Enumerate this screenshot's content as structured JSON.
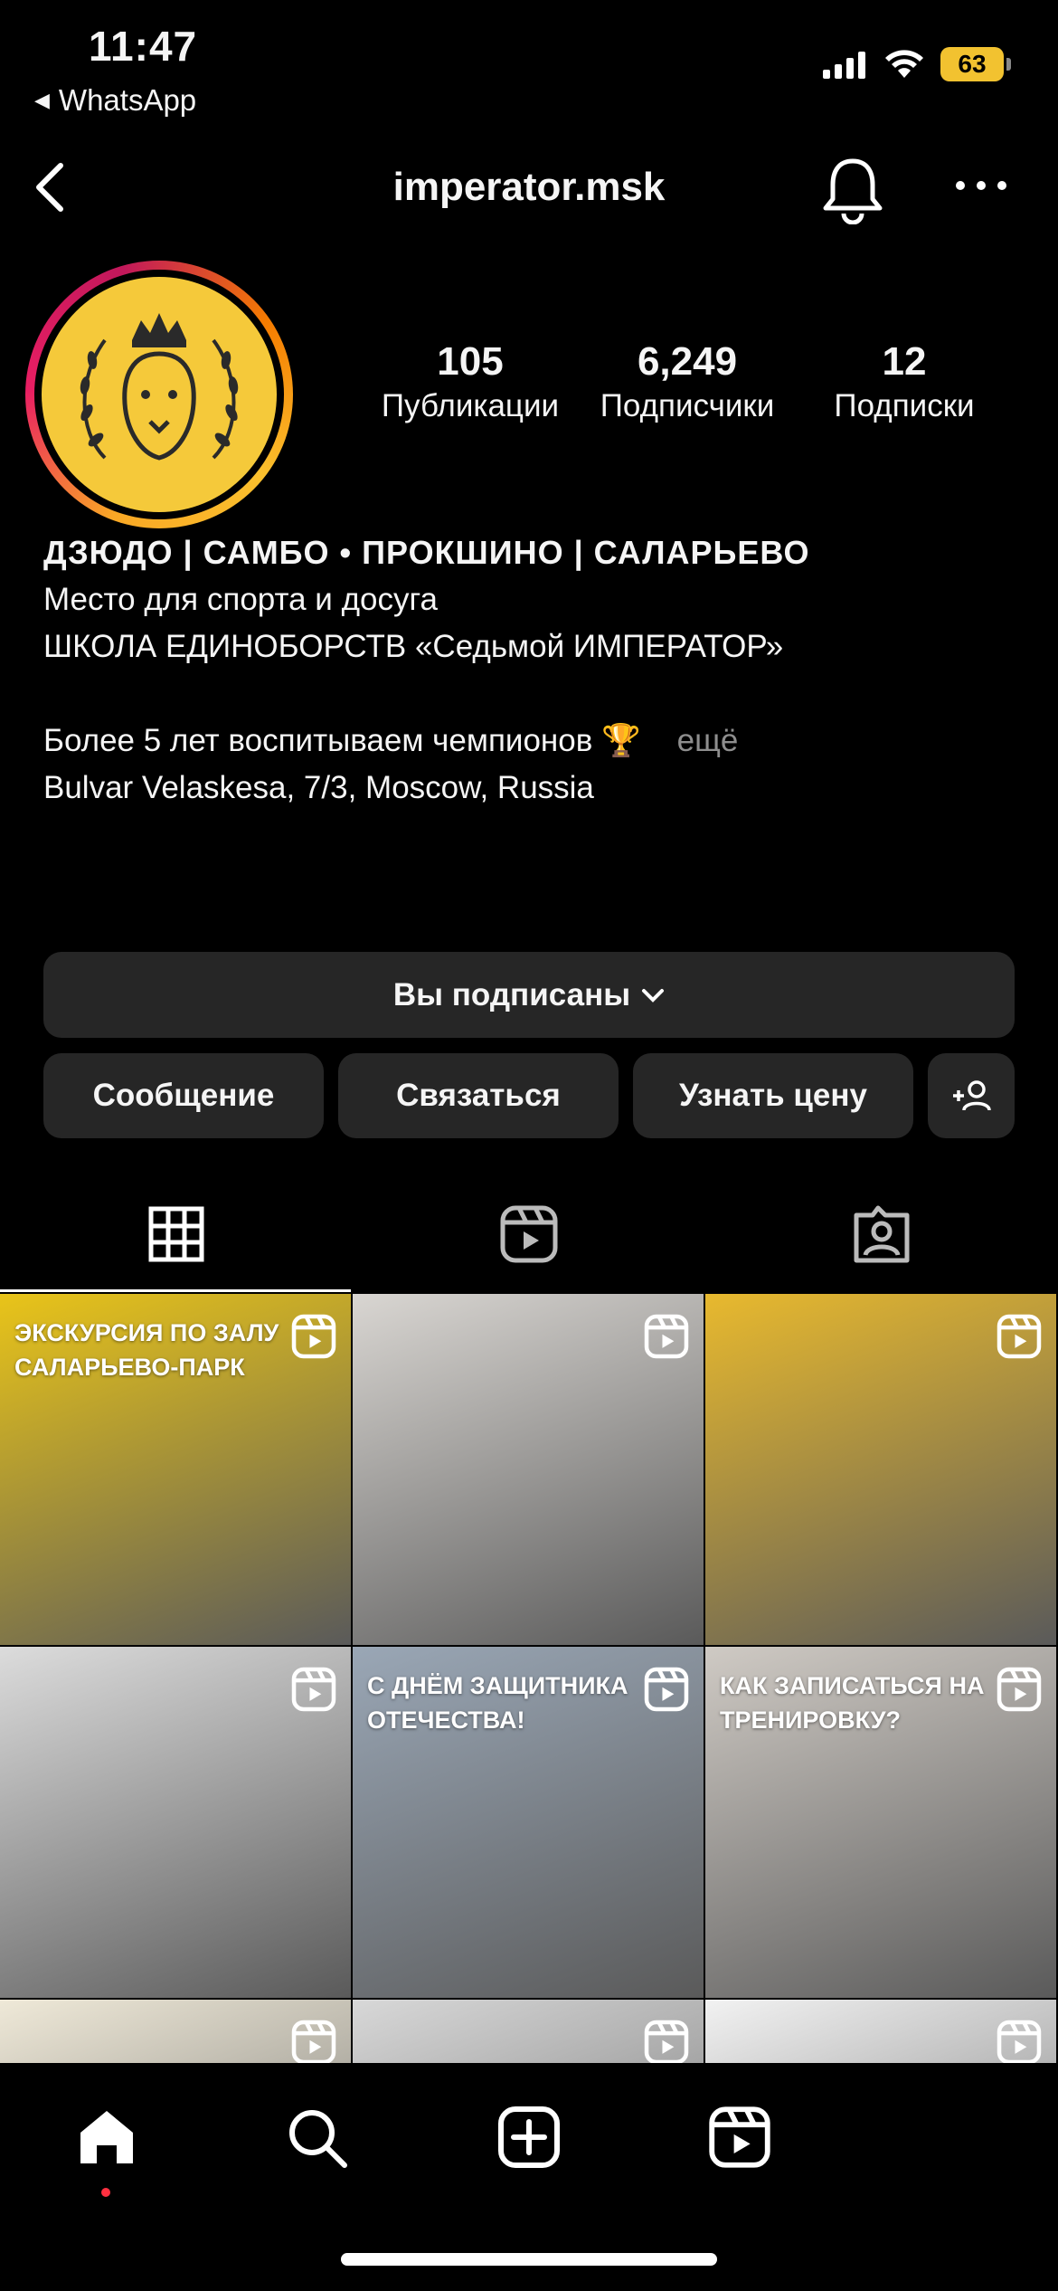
{
  "status": {
    "time": "11:47",
    "back_app": "WhatsApp",
    "battery": "63",
    "icons": [
      "cellular-icon",
      "wifi-icon",
      "battery-icon"
    ]
  },
  "header": {
    "username": "imperator.msk",
    "icons": [
      "back-icon",
      "bell-icon",
      "more-icon"
    ]
  },
  "profile": {
    "stats": [
      {
        "value": "105",
        "label": "Публикации"
      },
      {
        "value": "6,249",
        "label": "Подписчики"
      },
      {
        "value": "12",
        "label": "Подписки"
      }
    ],
    "bio": {
      "name": "ДЗЮДО | САМБО • ПРОКШИНО | САЛАРЬЕВО",
      "line1": "Место для спорта и досуга",
      "line2": "ШКОЛА ЕДИНОБОРСТВ «Седьмой ИМПЕРАТОР»",
      "line3": "Более 5 лет воспитываем чемпионов 🏆",
      "more": "ещё",
      "address": "Bulvar Velaskesa, 7/3, Moscow, Russia"
    }
  },
  "buttons": {
    "following": "Вы подписаны",
    "message": "Сообщение",
    "contact": "Связаться",
    "price": "Узнать цену"
  },
  "tabs": [
    "grid-icon",
    "reels-icon",
    "tagged-icon"
  ],
  "grid": [
    {
      "caption": "ЭКСКУРСИЯ ПО ЗАЛУ САЛАРЬЕВО-ПАРК",
      "bg": "#e9c419"
    },
    {
      "caption": "",
      "bg": "#d9d6d2"
    },
    {
      "caption": "",
      "bg": "#e8b92e"
    },
    {
      "caption": "",
      "bg": "#dcdcdc"
    },
    {
      "caption": "С ДНЁМ ЗАЩИТНИКА ОТЕЧЕСТВА!",
      "bg": "#9aa7b6"
    },
    {
      "caption": "КАК ЗАПИСАТЬСЯ НА ТРЕНИРОВКУ?",
      "bg": "#cfcac4"
    },
    {
      "caption": "",
      "bg": "#efe9d8"
    },
    {
      "caption": "",
      "bg": "#d8d8d8"
    },
    {
      "caption": "",
      "bg": "#f2f2f2"
    }
  ],
  "nav": [
    "home-icon",
    "search-icon",
    "create-icon",
    "reels-icon"
  ],
  "colors": {
    "background": "#000000",
    "button": "#262626",
    "accent_yellow": "#f5c93a",
    "notification_dot": "#ff3040"
  }
}
